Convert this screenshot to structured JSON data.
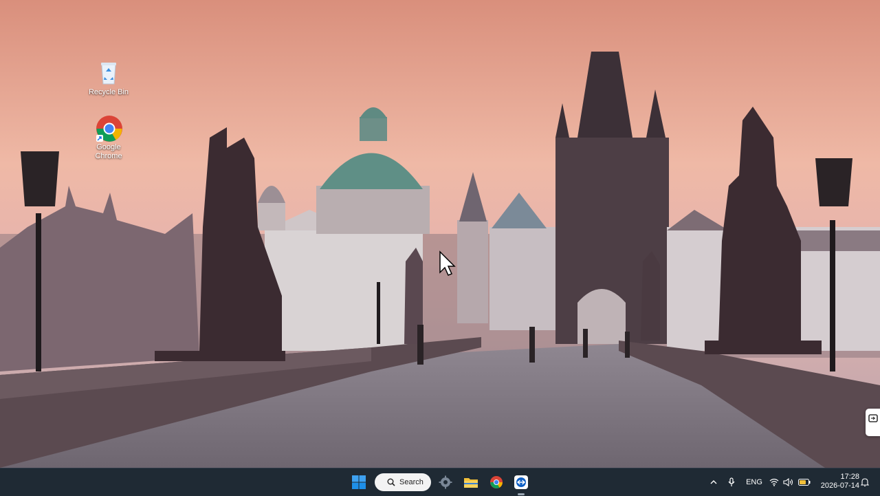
{
  "desktop": {
    "wallpaper": "charles-bridge-dawn",
    "icons": [
      {
        "label": "Recycle Bin",
        "icon": "recycle-bin-icon"
      },
      {
        "label": "Google Chrome",
        "icon": "chrome-icon"
      }
    ]
  },
  "taskbar": {
    "search_label": "Search",
    "pinned": [
      "windows-start-icon",
      "settings-gear-icon",
      "file-explorer-icon",
      "chrome-icon",
      "teamviewer-icon"
    ],
    "tray": {
      "language": "ENG",
      "time": "17:28",
      "date": "2026-07-14"
    }
  },
  "colors": {
    "taskbar_bg": "#1f2a34",
    "sky_top": "#f2c6b0",
    "sky_bottom": "#b98a90",
    "windows_blue": "#1e8fe8",
    "folder_yellow": "#f3c13a"
  }
}
